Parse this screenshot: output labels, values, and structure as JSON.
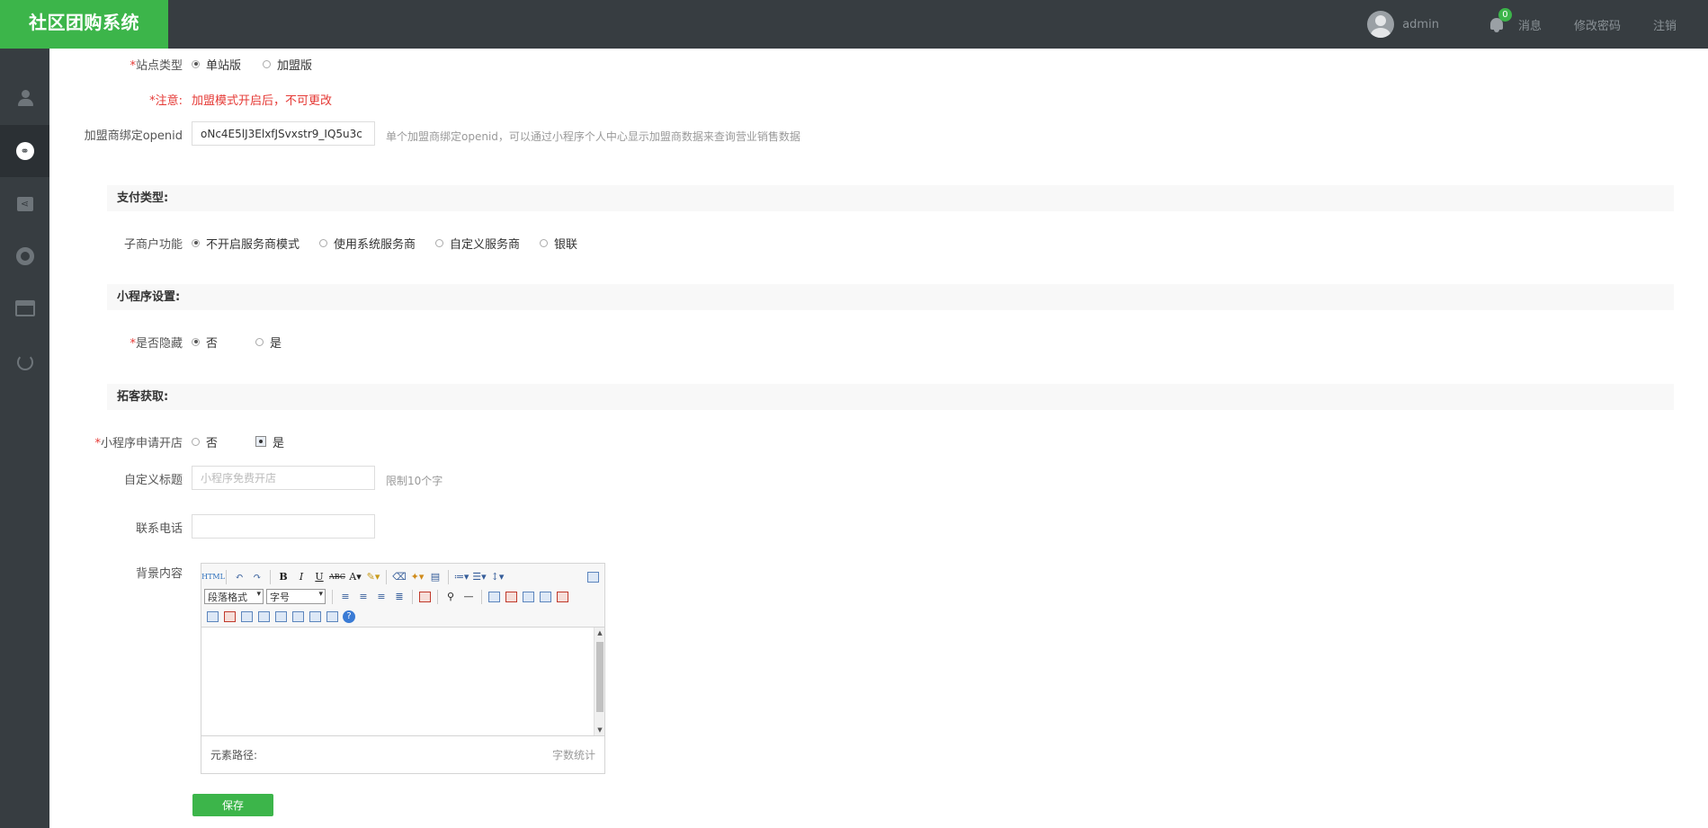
{
  "app": {
    "title": "社区团购系统"
  },
  "topbar": {
    "username": "admin",
    "messages_label": "消息",
    "messages_count": "0",
    "change_password": "修改密码",
    "logout": "注销"
  },
  "sidebar": {
    "icons": [
      "user-icon",
      "link-icon",
      "share-icon",
      "gear-icon",
      "store-icon",
      "refresh-icon"
    ],
    "active_index": 1
  },
  "form": {
    "site_type": {
      "label": "站点类型",
      "options": [
        "单站版",
        "加盟版"
      ],
      "selected": "单站版"
    },
    "notice": {
      "label": "注意:",
      "text": "加盟模式开启后，不可更改"
    },
    "openid": {
      "label": "加盟商绑定openid",
      "value": "oNc4E5lJ3ElxfJSvxstr9_IQ5u3c",
      "hint": "单个加盟商绑定openid，可以通过小程序个人中心显示加盟商数据来查询营业销售数据"
    },
    "payment_section": "支付类型:",
    "sub_merchant": {
      "label": "子商户功能",
      "options": [
        "不开启服务商模式",
        "使用系统服务商",
        "自定义服务商",
        "银联"
      ],
      "selected": "不开启服务商模式"
    },
    "miniprogram_section": "小程序设置:",
    "hidden": {
      "label": "是否隐藏",
      "options": [
        "否",
        "是"
      ],
      "selected": "否"
    },
    "acquire_section": "拓客获取:",
    "apply_store": {
      "label": "小程序申请开店",
      "options": [
        "否",
        "是"
      ],
      "selected": "是"
    },
    "custom_title": {
      "label": "自定义标题",
      "placeholder": "小程序免费开店",
      "hint": "限制10个字"
    },
    "phone": {
      "label": "联系电话",
      "value": ""
    },
    "background": {
      "label": "背景内容"
    }
  },
  "editor": {
    "paragraph_format": "段落格式",
    "font_size": "字号",
    "element_path": "元素路径:",
    "word_count": "字数统计"
  },
  "actions": {
    "save": "保存"
  }
}
